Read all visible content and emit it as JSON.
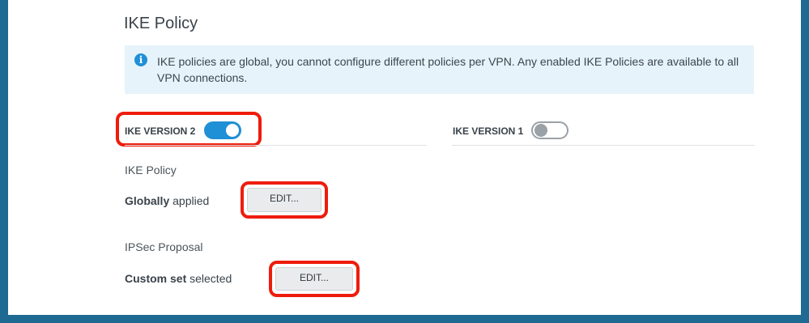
{
  "section": {
    "title": "IKE Policy",
    "info_text": "IKE policies are global, you cannot configure different policies per VPN. Any enabled IKE Policies are available to all VPN connections."
  },
  "ike_v2": {
    "label": "IKE VERSION 2",
    "enabled": true
  },
  "ike_v1": {
    "label": "IKE VERSION 1",
    "enabled": false
  },
  "ike_policy": {
    "label": "IKE Policy",
    "value_bold": "Globally",
    "value_rest": " applied",
    "edit_label": "EDIT..."
  },
  "ipsec_proposal": {
    "label": "IPSec Proposal",
    "value_bold": "Custom set",
    "value_rest": " selected",
    "edit_label": "EDIT..."
  },
  "colors": {
    "accent": "#1f8fd6",
    "highlight": "#ee1c0c",
    "frame": "#1f6a93",
    "info_bg": "#e6f3fb"
  }
}
